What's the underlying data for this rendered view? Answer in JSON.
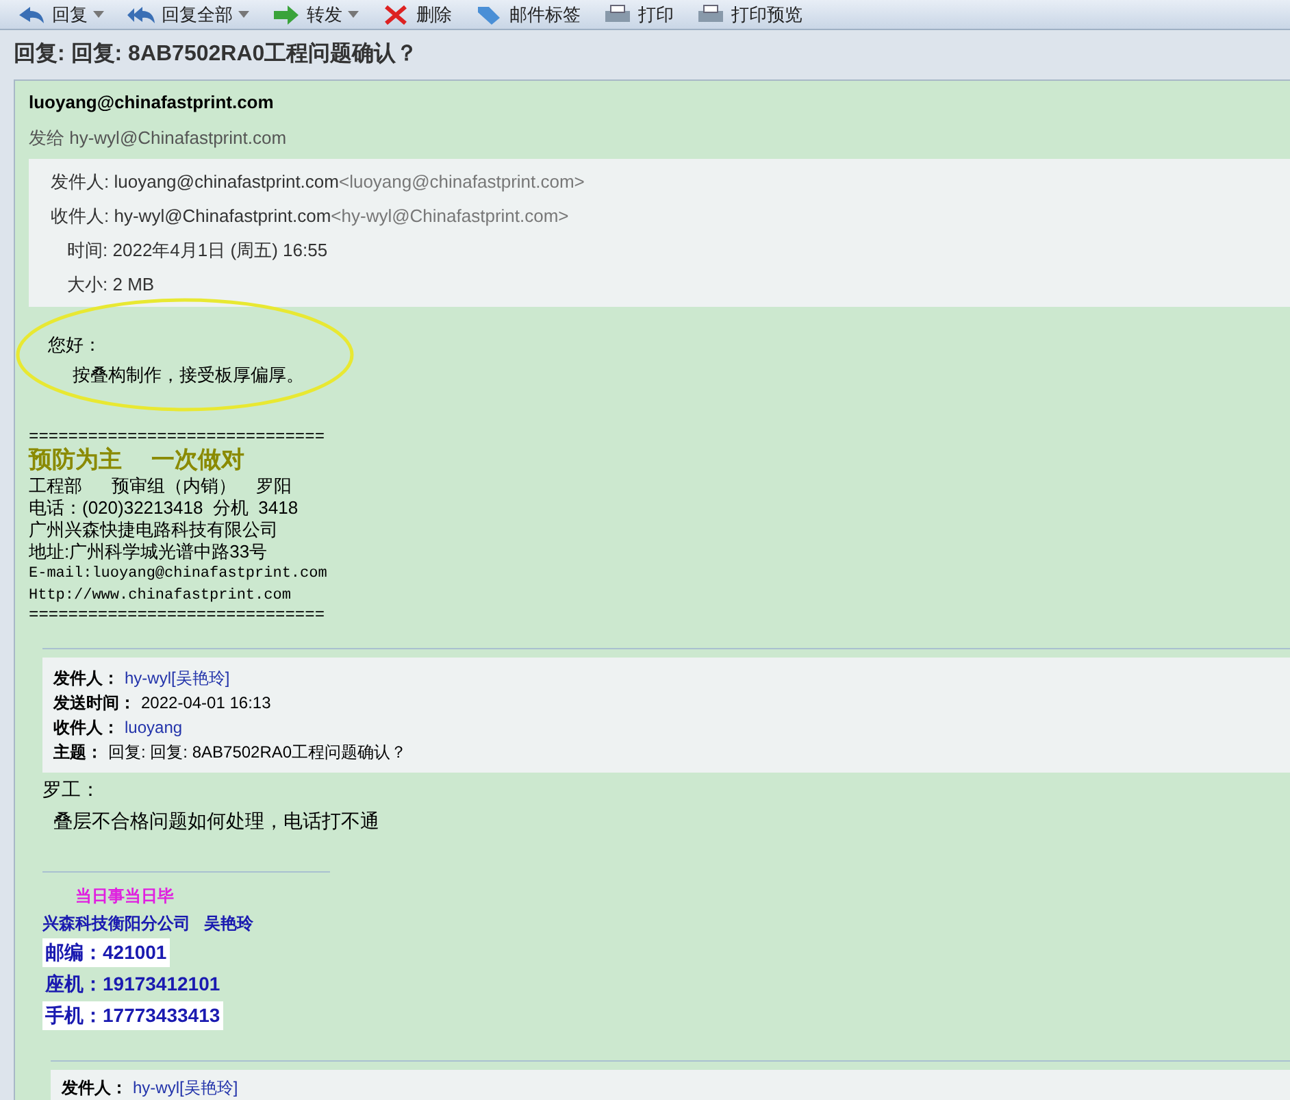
{
  "toolbar": {
    "buttons": [
      {
        "kind": "reply",
        "label": "回复",
        "dropdown": true
      },
      {
        "kind": "reply_all",
        "label": "回复全部",
        "dropdown": true
      },
      {
        "kind": "forward",
        "label": "转发",
        "dropdown": true
      },
      {
        "kind": "delete",
        "label": "删除",
        "dropdown": false
      },
      {
        "kind": "tag",
        "label": "邮件标签",
        "dropdown": false
      },
      {
        "kind": "print",
        "label": "打印",
        "dropdown": false
      },
      {
        "kind": "print_preview",
        "label": "打印预览",
        "dropdown": false
      }
    ]
  },
  "subject": "回复: 回复: 8AB7502RA0工程问题确认？",
  "message": {
    "sender": "luoyang@chinafastprint.com",
    "to_line": "发给 hy-wyl@Chinafastprint.com",
    "header_fields": [
      {
        "label": "发件人:",
        "value": "luoyang@chinafastprint.com",
        "address": "<luoyang@chinafastprint.com>"
      },
      {
        "label": "收件人:",
        "value": "hy-wyl@Chinafastprint.com",
        "address": "<hy-wyl@Chinafastprint.com>"
      },
      {
        "label": "时间:",
        "value": "2022年4月1日 (周五) 16:55"
      },
      {
        "label": "大小:",
        "value": "2 MB"
      }
    ],
    "greeting": "您好：",
    "body": "按叠构制作，接受板厚偏厚。",
    "highlighted": true,
    "signature": {
      "separator": "==============================",
      "motto": "预防为主　 一次做对",
      "lines": [
        {
          "kind": "text",
          "text": "工程部      预审组（内销）    罗阳"
        },
        {
          "kind": "text",
          "text": "电话：(020)32213418  分机  3418"
        },
        {
          "kind": "text",
          "text": "广州兴森快捷电路科技有限公司"
        },
        {
          "kind": "text",
          "text": "地址:广州科学城光谱中路33号"
        },
        {
          "kind": "mono",
          "text": "E-mail:luoyang@chinafastprint.com"
        },
        {
          "kind": "mono",
          "text": "Http://www.chinafastprint.com"
        }
      ],
      "separator_end": "=============================="
    }
  },
  "quoted": {
    "header_fields": [
      {
        "label": "发件人：",
        "value": "hy-wyl[吴艳玲]",
        "link": true
      },
      {
        "label": "发送时间：",
        "value": "2022-04-01 16:13",
        "link": false
      },
      {
        "label": "收件人：",
        "value": "luoyang",
        "link": true
      },
      {
        "label": "主题：",
        "value": "回复: 回复: 8AB7502RA0工程问题确认？",
        "link": false
      }
    ],
    "greeting": "罗工：",
    "body": "叠层不合格问题如何处理，电话打不通",
    "signature": {
      "motto": "当日事当日毕",
      "company": "兴森科技衡阳分公司   吴艳玲",
      "lines": [
        {
          "text": "邮编：421001",
          "highlighted": true
        },
        {
          "text": "座机：19173412101",
          "highlighted": false
        },
        {
          "text": "手机：17773433413",
          "highlighted": true
        }
      ]
    }
  },
  "quoted_2": {
    "header_fields": [
      {
        "label": "发件人：",
        "value": "hy-wyl[吴艳玲]",
        "link": true
      }
    ]
  }
}
